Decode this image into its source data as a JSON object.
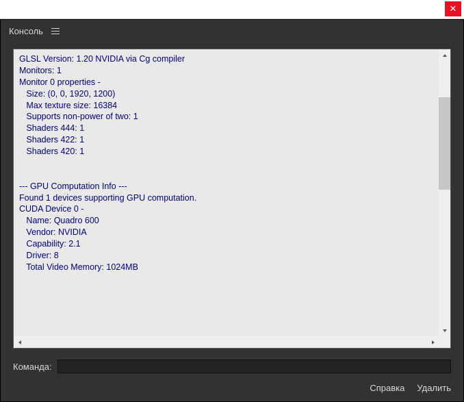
{
  "header": {
    "title": "Консоль"
  },
  "log": {
    "lines": [
      "GLSL Version: 1.20 NVIDIA via Cg compiler",
      "Monitors: 1",
      "Monitor 0 properties -",
      "   Size: (0, 0, 1920, 1200)",
      "   Max texture size: 16384",
      "   Supports non-power of two: 1",
      "   Shaders 444: 1",
      "   Shaders 422: 1",
      "   Shaders 420: 1",
      "",
      "",
      "--- GPU Computation Info ---",
      "Found 1 devices supporting GPU computation.",
      "CUDA Device 0 -",
      "   Name: Quadro 600",
      "   Vendor: NVIDIA",
      "   Capability: 2.1",
      "   Driver: 8",
      "   Total Video Memory: 1024MB"
    ]
  },
  "command": {
    "label": "Команда:",
    "value": ""
  },
  "footer": {
    "help": "Справка",
    "delete": "Удалить"
  }
}
